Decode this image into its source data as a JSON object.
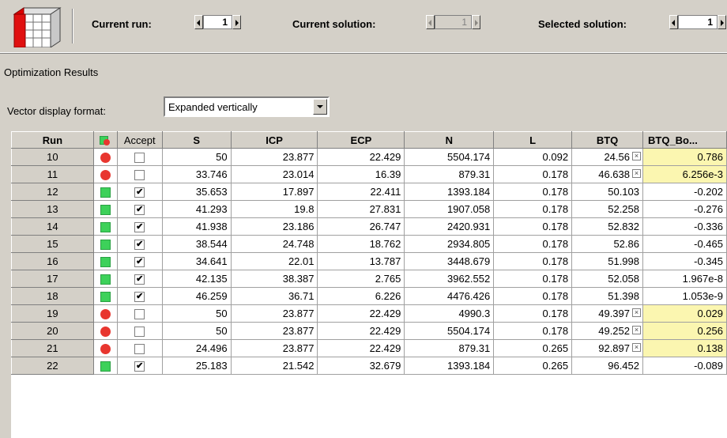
{
  "toolbar": {
    "current_run_label": "Current run:",
    "current_run_value": "1",
    "current_solution_label": "Current solution:",
    "current_solution_value": "1",
    "selected_solution_label": "Selected solution:",
    "selected_solution_value": "1"
  },
  "panel": {
    "title": "Optimization Results",
    "vector_format_label": "Vector display format:",
    "vector_format_value": "Expanded vertically"
  },
  "columns": [
    "Run",
    "",
    "Accept",
    "S",
    "ICP",
    "ECP",
    "N",
    "L",
    "BTQ",
    "BTQ_Bo..."
  ],
  "rows": [
    {
      "run": "10",
      "status": "red",
      "accept": false,
      "S": "50",
      "ICP": "23.877",
      "ECP": "22.429",
      "N": "5504.174",
      "L": "0.092",
      "BTQ": "24.56",
      "flag": true,
      "BTQ_Bo": "0.786"
    },
    {
      "run": "11",
      "status": "red",
      "accept": false,
      "S": "33.746",
      "ICP": "23.014",
      "ECP": "16.39",
      "N": "879.31",
      "L": "0.178",
      "BTQ": "46.638",
      "flag": true,
      "BTQ_Bo": "6.256e-3"
    },
    {
      "run": "12",
      "status": "green",
      "accept": true,
      "S": "35.653",
      "ICP": "17.897",
      "ECP": "22.411",
      "N": "1393.184",
      "L": "0.178",
      "BTQ": "50.103",
      "flag": false,
      "BTQ_Bo": "-0.202"
    },
    {
      "run": "13",
      "status": "green",
      "accept": true,
      "S": "41.293",
      "ICP": "19.8",
      "ECP": "27.831",
      "N": "1907.058",
      "L": "0.178",
      "BTQ": "52.258",
      "flag": false,
      "BTQ_Bo": "-0.276"
    },
    {
      "run": "14",
      "status": "green",
      "accept": true,
      "S": "41.938",
      "ICP": "23.186",
      "ECP": "26.747",
      "N": "2420.931",
      "L": "0.178",
      "BTQ": "52.832",
      "flag": false,
      "BTQ_Bo": "-0.336"
    },
    {
      "run": "15",
      "status": "green",
      "accept": true,
      "S": "38.544",
      "ICP": "24.748",
      "ECP": "18.762",
      "N": "2934.805",
      "L": "0.178",
      "BTQ": "52.86",
      "flag": false,
      "BTQ_Bo": "-0.465"
    },
    {
      "run": "16",
      "status": "green",
      "accept": true,
      "S": "34.641",
      "ICP": "22.01",
      "ECP": "13.787",
      "N": "3448.679",
      "L": "0.178",
      "BTQ": "51.998",
      "flag": false,
      "BTQ_Bo": "-0.345"
    },
    {
      "run": "17",
      "status": "green",
      "accept": true,
      "S": "42.135",
      "ICP": "38.387",
      "ECP": "2.765",
      "N": "3962.552",
      "L": "0.178",
      "BTQ": "52.058",
      "flag": false,
      "BTQ_Bo": "1.967e-8"
    },
    {
      "run": "18",
      "status": "green",
      "accept": true,
      "S": "46.259",
      "ICP": "36.71",
      "ECP": "6.226",
      "N": "4476.426",
      "L": "0.178",
      "BTQ": "51.398",
      "flag": false,
      "BTQ_Bo": "1.053e-9"
    },
    {
      "run": "19",
      "status": "red",
      "accept": false,
      "S": "50",
      "ICP": "23.877",
      "ECP": "22.429",
      "N": "4990.3",
      "L": "0.178",
      "BTQ": "49.397",
      "flag": true,
      "BTQ_Bo": "0.029"
    },
    {
      "run": "20",
      "status": "red",
      "accept": false,
      "S": "50",
      "ICP": "23.877",
      "ECP": "22.429",
      "N": "5504.174",
      "L": "0.178",
      "BTQ": "49.252",
      "flag": true,
      "BTQ_Bo": "0.256"
    },
    {
      "run": "21",
      "status": "red",
      "accept": false,
      "S": "24.496",
      "ICP": "23.877",
      "ECP": "22.429",
      "N": "879.31",
      "L": "0.265",
      "BTQ": "92.897",
      "flag": true,
      "BTQ_Bo": "0.138"
    },
    {
      "run": "22",
      "status": "green",
      "accept": true,
      "S": "25.183",
      "ICP": "21.542",
      "ECP": "32.679",
      "N": "1393.184",
      "L": "0.265",
      "BTQ": "96.452",
      "flag": false,
      "BTQ_Bo": "-0.089"
    }
  ],
  "colors": {
    "red_status": "#e8362f",
    "green_status": "#3dd15a",
    "highlight": "#fbf6b0"
  },
  "icons": {
    "toolbar": "cube-grid-icon",
    "status_header": "status-icon",
    "flag": "cross-box-icon"
  }
}
